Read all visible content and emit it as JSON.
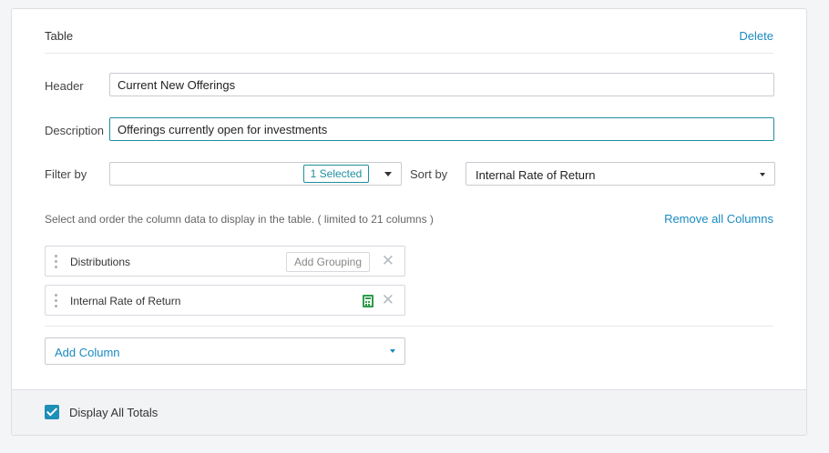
{
  "panel": {
    "title": "Table",
    "delete_label": "Delete"
  },
  "header_field": {
    "label": "Header",
    "value": "Current New Offerings"
  },
  "description_field": {
    "label": "Description",
    "value": "Offerings currently open for investments"
  },
  "filter": {
    "label": "Filter by",
    "selected_chip": "1 Selected"
  },
  "sort": {
    "label": "Sort by",
    "value": "Internal Rate of Return"
  },
  "columns": {
    "hint": "Select and order the column data to display in the table.  ( limited to 21 columns )",
    "remove_all_label": "Remove all Columns",
    "items": [
      {
        "name": "Distributions",
        "action_label": "Add Grouping",
        "remove_glyph": "✕"
      },
      {
        "name": "Internal Rate of Return",
        "icon": "calculator-icon",
        "remove_glyph": "✕"
      }
    ],
    "add_column_label": "Add Column"
  },
  "footer": {
    "checkbox_checked": true,
    "checkbox_label": "Display All Totals"
  },
  "colors": {
    "accent": "#1a8ac2",
    "focus": "#1e8fa0",
    "calculator": "#2e9b4c"
  }
}
